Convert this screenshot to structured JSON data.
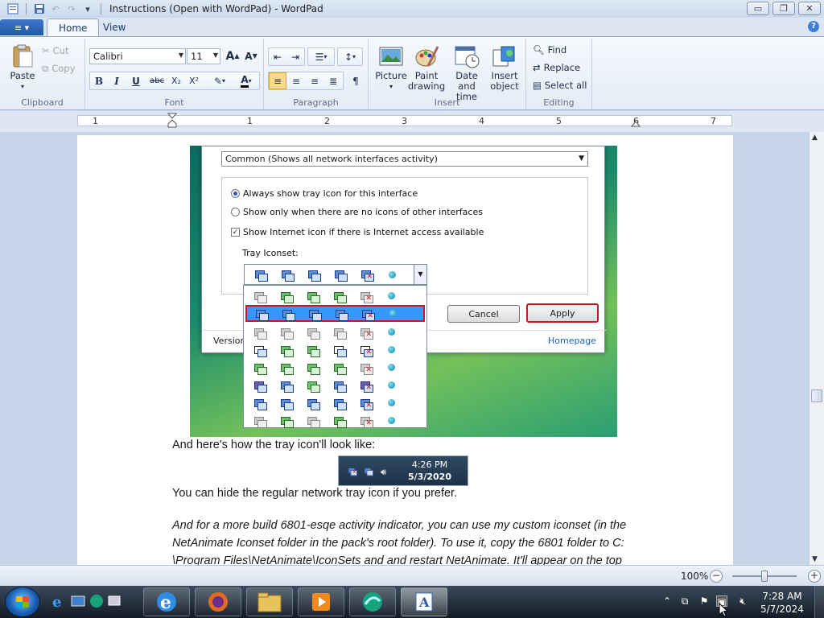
{
  "window": {
    "title": "Instructions (Open with WordPad) - WordPad",
    "minimize": "▭",
    "maximize": "❐",
    "close": "✕"
  },
  "qat": {
    "save_icon": "save-icon",
    "undo_icon": "undo-icon",
    "redo_icon": "redo-icon",
    "customize_icon": "chevron-down-icon"
  },
  "tabs": {
    "app_menu": "≡ ▾",
    "home": "Home",
    "view": "View",
    "help": "?"
  },
  "ribbon": {
    "clipboard": {
      "label": "Clipboard",
      "paste": "Paste",
      "cut": "Cut",
      "copy": "Copy"
    },
    "font": {
      "label": "Font",
      "family": "Calibri",
      "size": "11",
      "grow": "A",
      "shrink": "A",
      "bold": "B",
      "italic": "I",
      "underline": "U",
      "strikethrough": "abc",
      "subscript": "X₂",
      "superscript": "X²",
      "highlight": "✎",
      "color": "A"
    },
    "paragraph": {
      "label": "Paragraph"
    },
    "insert": {
      "label": "Insert",
      "picture": "Picture",
      "paint_line1": "Paint",
      "paint_line2": "drawing",
      "datetime_line1": "Date and",
      "datetime_line2": "time",
      "object_line1": "Insert",
      "object_line2": "object"
    },
    "editing": {
      "label": "Editing",
      "find": "Find",
      "replace": "Replace",
      "select_all": "Select all"
    }
  },
  "ruler": {
    "numbers": [
      "1",
      "1",
      "2",
      "3",
      "4",
      "5",
      "6",
      "7"
    ]
  },
  "dialog": {
    "select_value": "Common (Shows all network interfaces activity)",
    "opt_always": "Always show tray icon for this interface",
    "opt_only": "Show only when there are no icons of other interfaces",
    "opt_internet": "Show Internet icon if there is Internet access available",
    "tray_iconset": "Tray Iconset:",
    "cancel": "Cancel",
    "apply": "Apply",
    "version": "Versior",
    "homepage": "Homepage"
  },
  "tray_sample": {
    "time": "4:26 PM",
    "date": "5/3/2020"
  },
  "document": {
    "para1": "And here's how the tray icon'll look like:",
    "para2": "You can hide the regular network tray icon if you prefer.",
    "para3_line1": "And for a more build 6801-esqe activity indicator, you can use my custom iconset (in the",
    "para3_line2": "NetAnimate Iconset folder in the pack's root folder). To use it, copy the 6801 folder to C:",
    "para3_line3": "\\Program Files\\NetAnimate\\IconSets and and restart NetAnimate. It'll appear on the top"
  },
  "status": {
    "zoom": "100%",
    "zoom_out": "−",
    "zoom_in": "+",
    "zoom_level": 1.0
  },
  "taskbar": {
    "time": "7:28 AM",
    "date": "5/7/2024"
  }
}
